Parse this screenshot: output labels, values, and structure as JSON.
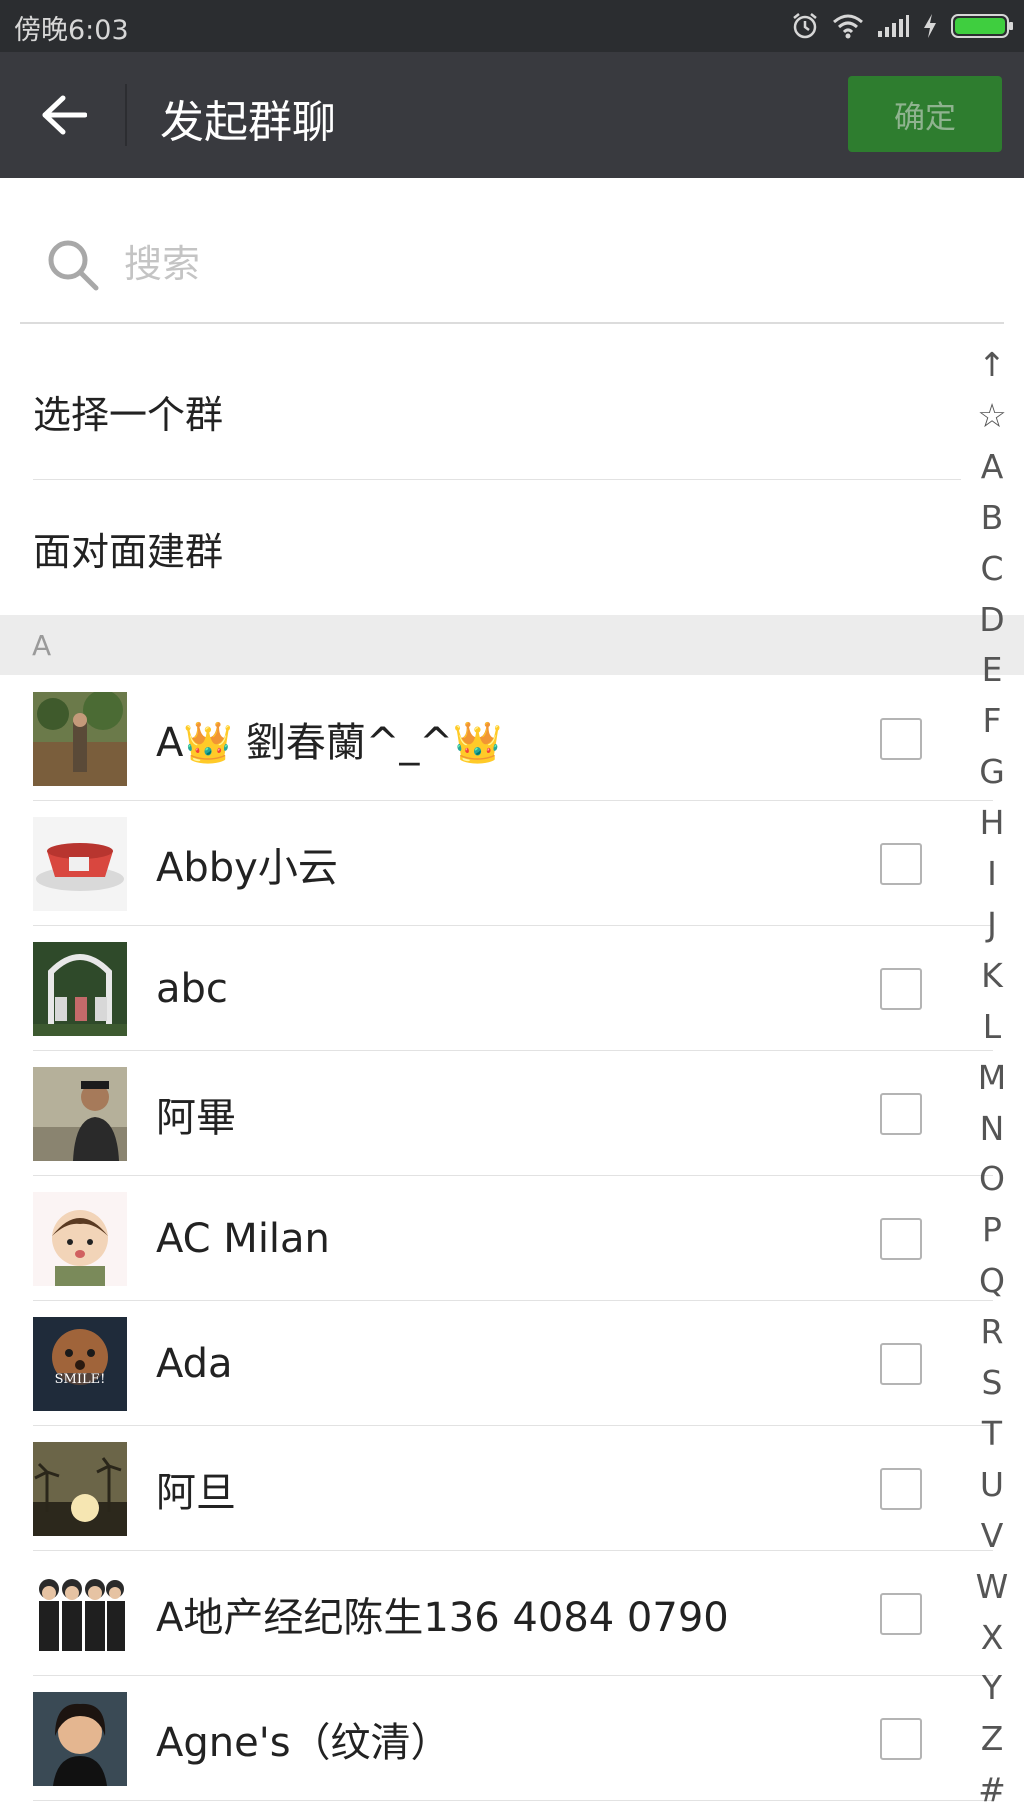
{
  "status_bar": {
    "time": "傍晚6:03",
    "icons": [
      "alarm-icon",
      "wifi-icon",
      "signal-icon",
      "charging-icon",
      "battery-icon"
    ]
  },
  "header": {
    "title": "发起群聊",
    "confirm_label": "确定",
    "back_icon": "back-arrow-icon"
  },
  "search": {
    "placeholder": "搜索",
    "icon": "search-icon"
  },
  "actions": [
    {
      "label": "选择一个群"
    },
    {
      "label": "面对面建群"
    }
  ],
  "section": {
    "label": "A"
  },
  "contacts": [
    {
      "name": "A👑 劉春蘭^_^👑",
      "checked": false
    },
    {
      "name": "Abby小云",
      "checked": false
    },
    {
      "name": "abc",
      "checked": false
    },
    {
      "name": "阿畢",
      "checked": false
    },
    {
      "name": "AC Milan",
      "checked": false
    },
    {
      "name": "Ada",
      "checked": false
    },
    {
      "name": "阿旦",
      "checked": false
    },
    {
      "name": "A地产经纪陈生136 4084 0790",
      "checked": false
    },
    {
      "name": "Agne's（纹清）",
      "checked": false
    }
  ],
  "index": [
    "↑",
    "☆",
    "A",
    "B",
    "C",
    "D",
    "E",
    "F",
    "G",
    "H",
    "I",
    "J",
    "K",
    "L",
    "M",
    "N",
    "O",
    "P",
    "Q",
    "R",
    "S",
    "T",
    "U",
    "V",
    "W",
    "X",
    "Y",
    "Z",
    "#"
  ],
  "colors": {
    "status_bar": "#2b2d30",
    "app_bar": "#393a3f",
    "confirm_button": "#2e7d2f",
    "section_header": "#ececec"
  }
}
